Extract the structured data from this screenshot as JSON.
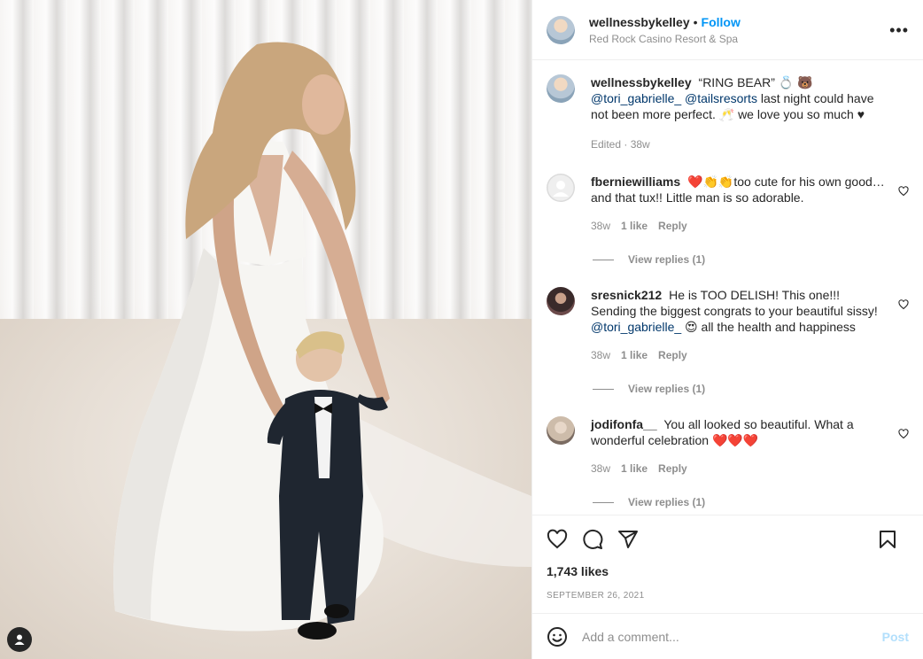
{
  "post": {
    "username": "wellnessbykelley",
    "follow_label": "Follow",
    "location": "Red Rock Casino Resort & Spa",
    "more_icon": "more-icon"
  },
  "caption": {
    "username": "wellnessbykelley",
    "text_1": "“RING BEAR” 💍 🐻",
    "mention_1": "@tori_gabrielle_",
    "mention_2": "@tailsresorts",
    "text_2": "last night could have not been more perfect. 🥂 we love you so much ♥",
    "edited": "Edited · 38w"
  },
  "comments": [
    {
      "username": "fberniewilliams",
      "text": "❤️👏👏too cute for his own good… and that tux!! Little man is so adorable.",
      "age": "38w",
      "likes": "1 like",
      "reply": "Reply",
      "view_replies": "View replies (1)"
    },
    {
      "username": "sresnick212",
      "text": "He is TOO DELISH! This one!!! Sending the biggest congrats to your beautiful sissy!",
      "mention": "@tori_gabrielle_",
      "text_after": "😍 all the health and happiness",
      "age": "38w",
      "likes": "1 like",
      "reply": "Reply",
      "view_replies": "View replies (1)"
    },
    {
      "username": "jodifonfa__",
      "text": "You all looked so beautiful. What a wonderful celebration ❤️❤️❤️",
      "age": "38w",
      "likes": "1 like",
      "reply": "Reply",
      "view_replies": "View replies (1)"
    }
  ],
  "stats": {
    "likes": "1,743 likes",
    "date": "SEPTEMBER 26, 2021"
  },
  "composer": {
    "placeholder": "Add a comment...",
    "post_label": "Post"
  },
  "colors": {
    "link": "#0095f6",
    "mention": "#00376b",
    "muted": "#8e8e8e"
  }
}
